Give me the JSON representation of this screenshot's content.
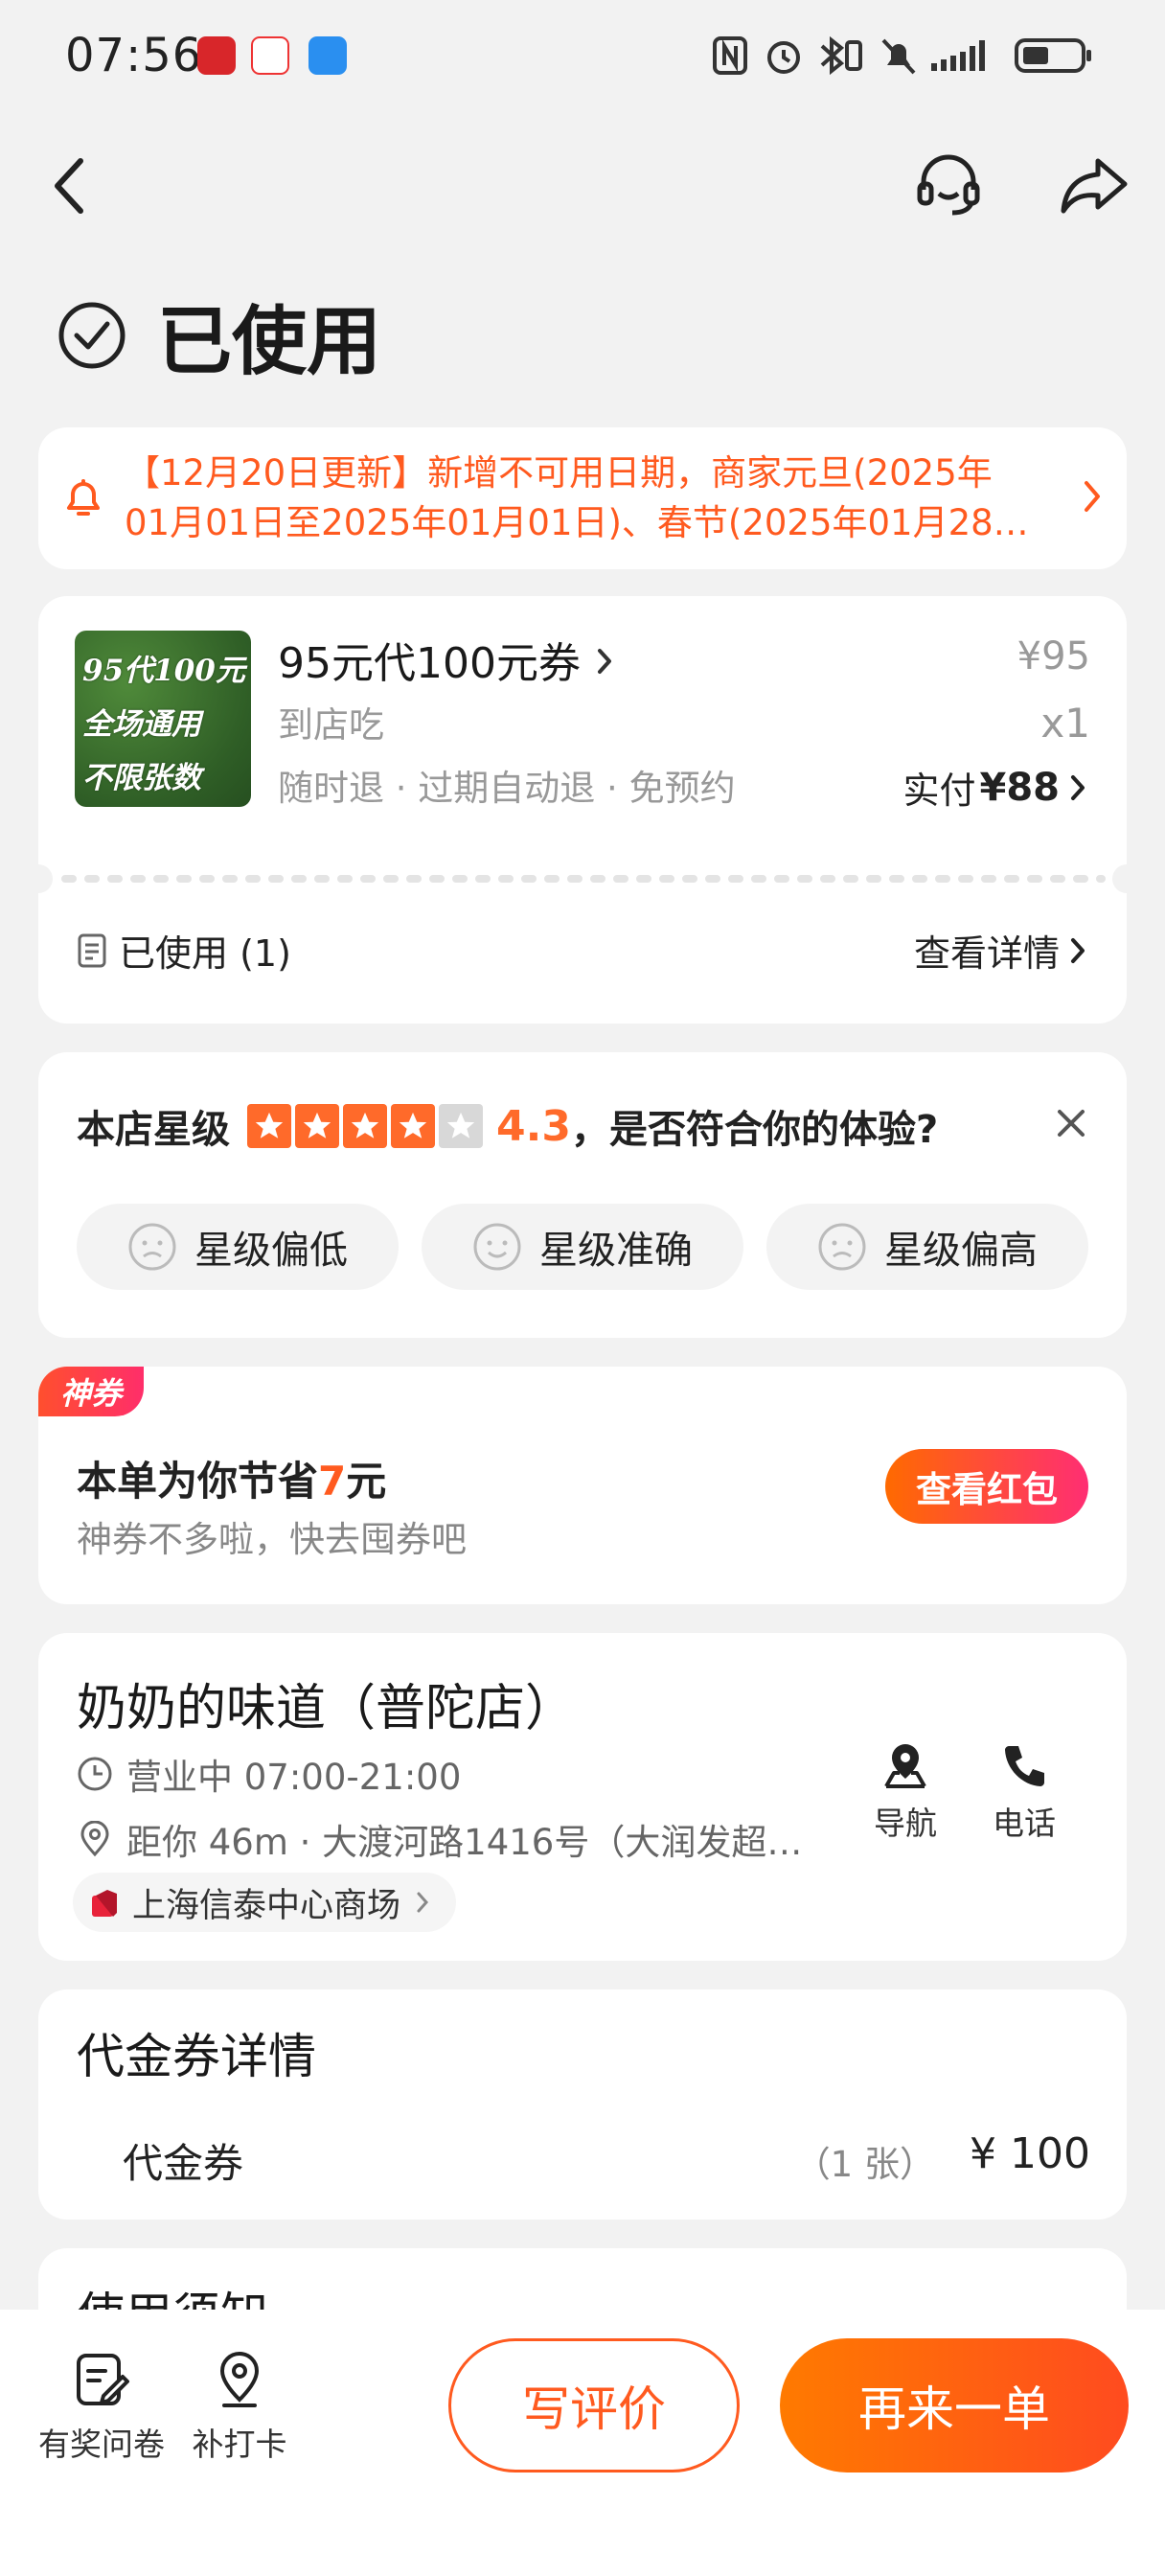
{
  "status_bar": {
    "time": "07:56"
  },
  "header": {
    "title": "已使用"
  },
  "notice": {
    "line1": "【12月20日更新】新增不可用日期，商家元旦(2025年",
    "line2": "01月01日至2025年01月01日)、春节(2025年01月28…"
  },
  "order": {
    "image_text": [
      "95代100元",
      "全场通用",
      "不限张数"
    ],
    "name": "95元代100元券",
    "type": "到店吃",
    "tags": "随时退 · 过期自动退 · 免预约",
    "price": "¥95",
    "qty": "x1",
    "paid_label": "实付",
    "paid_amount": "¥88",
    "used_label": "已使用 (1)",
    "detail_label": "查看详情"
  },
  "rating": {
    "label": "本店星级",
    "stars": 4.3,
    "score": "4.3",
    "question": "，是否符合你的体验?",
    "options": [
      "星级偏低",
      "星级准确",
      "星级偏高"
    ]
  },
  "saving": {
    "badge": "神券",
    "prefix": "本单为你节省",
    "amount": "7",
    "suffix": "元",
    "sub": "神券不多啦，快去囤券吧",
    "button": "查看红包"
  },
  "store": {
    "name": "奶奶的味道（普陀店）",
    "hours": "营业中 07:00-21:00",
    "address": "距你 46m ·  大渡河路1416号（大润发超…",
    "mall": "上海信泰中心商场",
    "nav_label": "导航",
    "call_label": "电话"
  },
  "voucher": {
    "title": "代金券详情",
    "item": "代金券",
    "count": "（1 张）",
    "amount": "¥ 100"
  },
  "usage": {
    "title": "使用须知"
  },
  "bottom": {
    "survey": "有奖问卷",
    "checkin": "补打卡",
    "review": "写评价",
    "reorder": "再来一单"
  },
  "colors": {
    "accent": "#ff5a1f",
    "star": "#ff6a2a",
    "background": "#f2f2f2"
  }
}
